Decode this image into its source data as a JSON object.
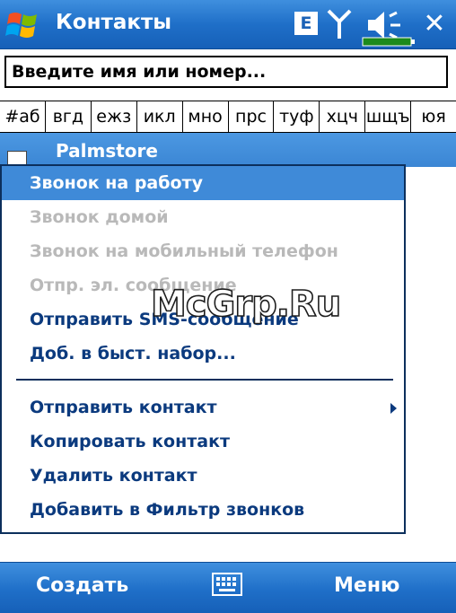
{
  "titlebar": {
    "title": "Контакты",
    "indicator_e": "E",
    "close_glyph": "✕"
  },
  "search": {
    "placeholder": "Введите имя или номер..."
  },
  "alpha_tabs": [
    "#аб",
    "вгд",
    "ежз",
    "икл",
    "мно",
    "прс",
    "туф",
    "хцч",
    "шщъ",
    "юя"
  ],
  "contact": {
    "name": "Palmstore"
  },
  "context_menu": {
    "items": [
      {
        "label": "Звонок на работу",
        "state": "selected"
      },
      {
        "label": "Звонок домой",
        "state": "disabled"
      },
      {
        "label": "Звонок на мобильный телефон",
        "state": "disabled"
      },
      {
        "label": "Отпр. эл. сообщение",
        "state": "disabled"
      },
      {
        "label": "Отправить SMS-сообщение",
        "state": "enabled"
      },
      {
        "label": "Доб. в быст. набор...",
        "state": "enabled"
      },
      {
        "label": "Отправить контакт",
        "state": "enabled",
        "submenu": true
      },
      {
        "label": "Копировать контакт",
        "state": "enabled"
      },
      {
        "label": "Удалить контакт",
        "state": "enabled"
      },
      {
        "label": "Добавить в Фильтр звонков",
        "state": "enabled"
      }
    ]
  },
  "watermark": "McGrp.Ru",
  "softkeys": {
    "left": "Создать",
    "right": "Меню"
  },
  "colors": {
    "accent": "#1f6fc8",
    "selection": "#3f8ad8",
    "menu_text": "#0b3a7e",
    "disabled_text": "#b9b9b9"
  },
  "icons": [
    "windows-start-icon",
    "signal-icon",
    "volume-icon",
    "battery-icon",
    "close-icon",
    "contact-card-icon",
    "submenu-arrow-icon",
    "keyboard-icon"
  ]
}
